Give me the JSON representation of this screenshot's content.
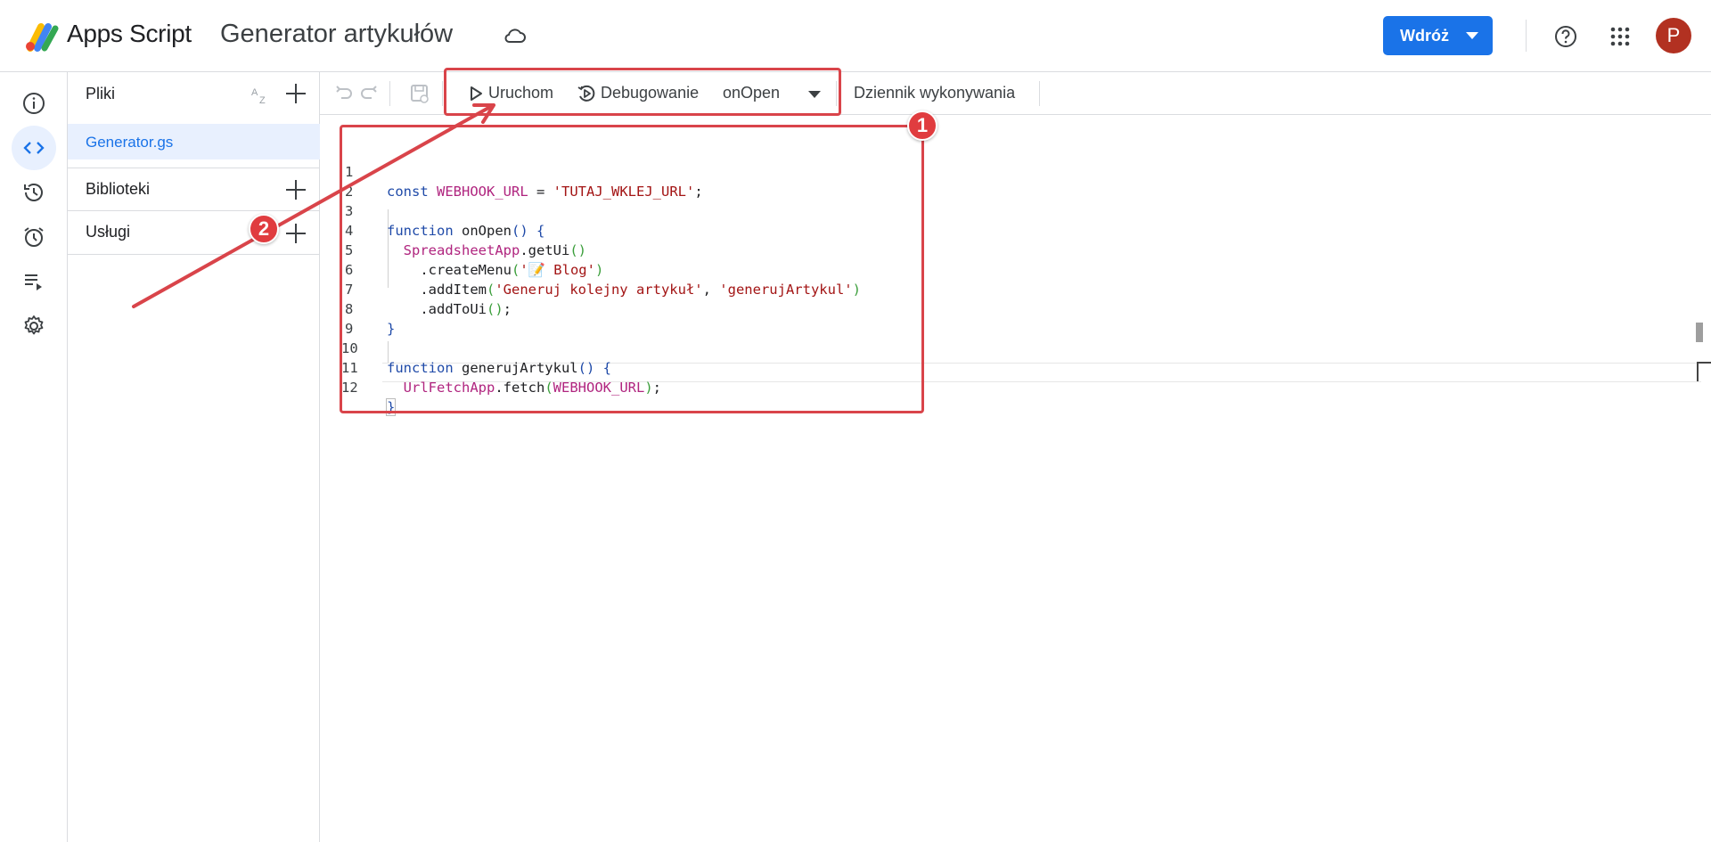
{
  "header": {
    "app_name": "Apps Script",
    "project_title": "Generator artykułów",
    "deploy_label": "Wdróż",
    "avatar_letter": "P"
  },
  "sidebar": {
    "items": [
      {
        "name": "overview",
        "icon": "info-icon"
      },
      {
        "name": "editor",
        "icon": "code-icon",
        "active": true
      },
      {
        "name": "versions",
        "icon": "history-icon"
      },
      {
        "name": "triggers",
        "icon": "alarm-icon"
      },
      {
        "name": "executions",
        "icon": "executions-icon"
      },
      {
        "name": "settings",
        "icon": "gear-icon"
      }
    ]
  },
  "files_panel": {
    "files_title": "Pliki",
    "files": [
      "Generator.gs"
    ],
    "libraries_title": "Biblioteki",
    "services_title": "Usługi"
  },
  "toolbar": {
    "run_label": "Uruchom",
    "debug_label": "Debugowanie",
    "function_selected": "onOpen",
    "execution_log_label": "Dziennik wykonywania"
  },
  "code_lines": [
    {
      "n": "1"
    },
    {
      "n": "2"
    },
    {
      "n": "3"
    },
    {
      "n": "4"
    },
    {
      "n": "5"
    },
    {
      "n": "6"
    },
    {
      "n": "7"
    },
    {
      "n": "8"
    },
    {
      "n": "9"
    },
    {
      "n": "10"
    },
    {
      "n": "11"
    },
    {
      "n": "12"
    }
  ],
  "code": {
    "l1_kw": "const",
    "l1_var": "WEBHOOK_URL",
    "l1_eq": " = ",
    "l1_str": "'TUTAJ_WKLEJ_URL'",
    "l1_end": ";",
    "l3_kw": "function",
    "l3_name": " onOpen",
    "l3_paren": "()",
    "l3_brace": " {",
    "l4_cls": "SpreadsheetApp",
    "l4_call": ".getUi",
    "l4_paren": "()",
    "l5_call": ".createMenu",
    "l5_open": "(",
    "l5_str": "'📝 Blog'",
    "l5_close": ")",
    "l6_call": ".addItem",
    "l6_open": "(",
    "l6_str1": "'Generuj kolejny artykuł'",
    "l6_comma": ", ",
    "l6_str2": "'generujArtykul'",
    "l6_close": ")",
    "l7_call": ".addToUi",
    "l7_paren": "()",
    "l7_end": ";",
    "l8_brace": "}",
    "l10_kw": "function",
    "l10_name": " generujArtykul",
    "l10_paren": "()",
    "l10_brace": " {",
    "l11_cls": "UrlFetchApp",
    "l11_call": ".fetch",
    "l11_open": "(",
    "l11_var": "WEBHOOK_URL",
    "l11_close": ")",
    "l11_end": ";",
    "l12_brace": "}"
  },
  "annotations": {
    "badge_1": "1",
    "badge_2": "2",
    "color": "#d9444a"
  }
}
